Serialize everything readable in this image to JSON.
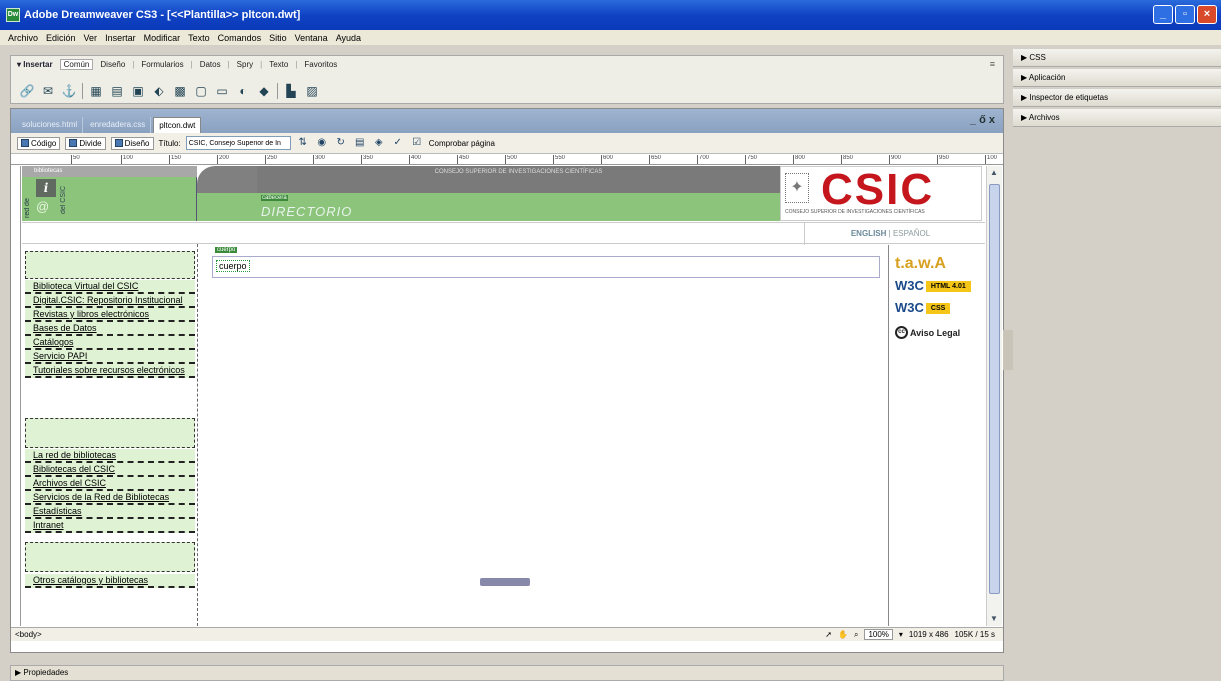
{
  "window": {
    "title": "Adobe Dreamweaver CS3 - [<<Plantilla>> pltcon.dwt]",
    "icon": "Dw"
  },
  "menu": [
    "Archivo",
    "Edición",
    "Ver",
    "Insertar",
    "Modificar",
    "Texto",
    "Comandos",
    "Sitio",
    "Ventana",
    "Ayuda"
  ],
  "insert_bar": {
    "label": "▾ Insertar",
    "tabs": [
      "Común",
      "Diseño",
      "Formularios",
      "Datos",
      "Spry",
      "Texto",
      "Favoritos"
    ],
    "active_tab": "Común",
    "options_icon": "≡",
    "tools": [
      "hyperlink-icon",
      "email-link-icon",
      "named-anchor-icon",
      "table-icon",
      "layer-icon",
      "image-icon",
      "media-icon",
      "date-icon",
      "server-include-icon",
      "comment-icon",
      "head-icon",
      "script-icon",
      "templates-icon",
      "tag-chooser-icon"
    ]
  },
  "doc_tabs": [
    "soluciones.html",
    "enredadera.css",
    "pltcon.dwt"
  ],
  "doc_window_controls": "_ ő x",
  "doc_toolbar": {
    "code": "Código",
    "split": "Divide",
    "design": "Diseño",
    "title_label": "Título:",
    "title_value": "CSIC, Consejo Superior de In",
    "check_page": "Comprobar página"
  },
  "ruler_ticks": [
    "50",
    "100",
    "150",
    "200",
    "250",
    "300",
    "350",
    "400",
    "450",
    "500",
    "550",
    "600",
    "650",
    "700",
    "750",
    "800",
    "850",
    "900",
    "950",
    "100"
  ],
  "page": {
    "bibliotecas": "bibliotecas",
    "red_de": "red de",
    "del_csic": "del CSIC",
    "consejo": "CONSEJO SUPERIOR DE INVESTIGACIONES CIENTÍFICAS",
    "cabecera_label": "cabecera",
    "directorio": "DIRECTORIO",
    "csic_logo": "CSIC",
    "csic_sub": "CONSEJO SUPERIOR DE INVESTIGACIONES CIENTÍFICAS",
    "lang_en": "ENGLISH",
    "lang_sep": "|",
    "lang_es": "ESPAÑOL",
    "cuerpo_label": "cuerpo",
    "cuerpo_text": "cuerpo",
    "nav_group1": [
      "Biblioteca Virtual del CSIC",
      "Digital.CSIC: Repositorio Institucional",
      "Revistas y libros electrónicos",
      "Bases de Datos",
      "Catálogos",
      "Servicio PAPI",
      "Tutoriales sobre recursos electrónicos"
    ],
    "nav_group2": [
      "La red de bibliotecas",
      "Bibliotecas del CSIC",
      "Archivos del CSIC",
      "Servicios de la Red de Bibliotecas",
      "Estadísticas",
      "Intranet"
    ],
    "nav_group3": [
      "Otros catálogos y bibliotecas"
    ],
    "badges": {
      "taw": "t.a.w.",
      "taw_a": "A",
      "w3c": "W3C",
      "html": "HTML 4.01",
      "css": "CSS",
      "cc": "cc",
      "aviso": "Aviso Legal"
    }
  },
  "status": {
    "tag": "<body>",
    "zoom": "100%",
    "size": "1019 x 486",
    "weight": "105K / 15 s"
  },
  "properties": "▶ Propiedades",
  "panels": [
    "▶ CSS",
    "▶ Aplicación",
    "▶ Inspector de etiquetas",
    "▶ Archivos"
  ]
}
